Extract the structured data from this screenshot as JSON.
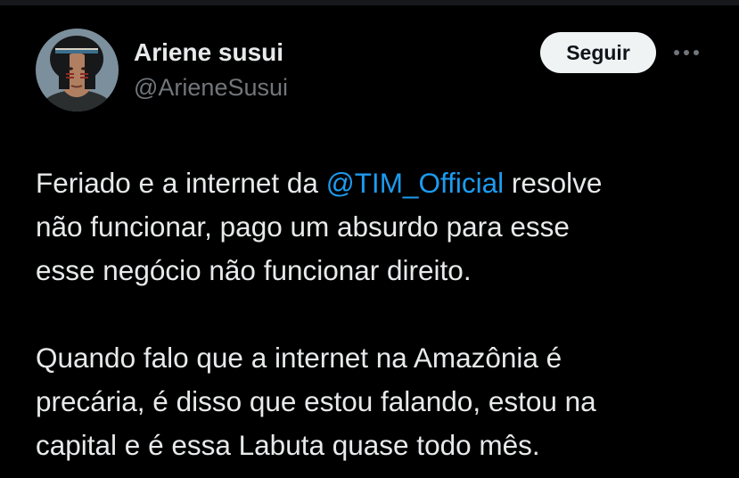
{
  "author": {
    "display_name": "Ariene susui",
    "handle": "@ArieneSusui"
  },
  "actions": {
    "follow_label": "Seguir",
    "more_icon": "more-horizontal-icon"
  },
  "tweet": {
    "p1_line1_before": "Feriado e a internet da ",
    "p1_mention": "@TIM_Official",
    "p1_line1_after": " resolve",
    "p1_line2": "não funcionar, pago um absurdo para esse",
    "p1_line3": "esse negócio não funcionar direito.",
    "p2_line1": "Quando falo que a  internet na Amazônia é",
    "p2_line2": "precária, é disso que estou falando, estou na",
    "p2_line3": "capital e é essa Labuta quase todo mês."
  },
  "colors": {
    "background": "#000000",
    "text": "#e7e9ea",
    "secondary_text": "#71767b",
    "link": "#1d9bf0",
    "button_bg": "#eff3f4"
  }
}
